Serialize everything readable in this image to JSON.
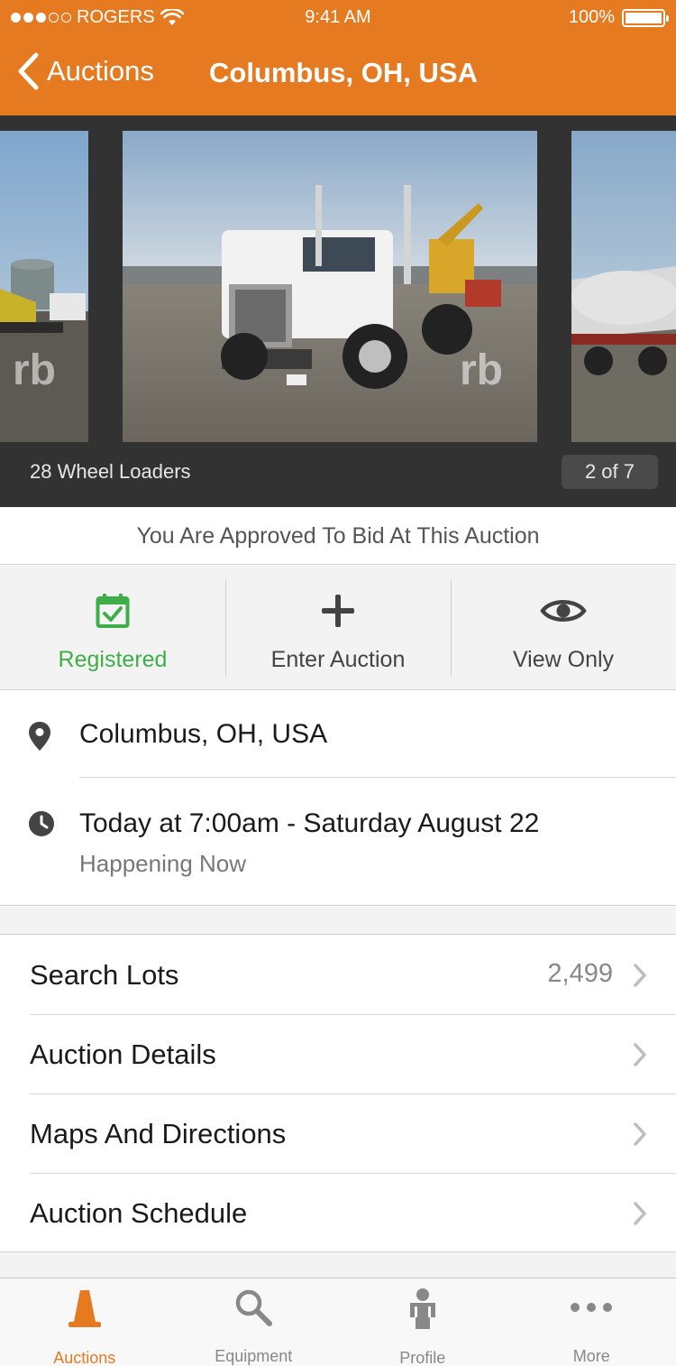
{
  "status_bar": {
    "carrier": "ROGERS",
    "time": "9:41 AM",
    "battery": "100%"
  },
  "nav": {
    "back_label": "Auctions",
    "title": "Columbus, OH, USA"
  },
  "gallery": {
    "caption": "28 Wheel Loaders",
    "counter": "2 of 7",
    "watermark": "rb"
  },
  "approved_text": "You Are Approved To Bid At This Auction",
  "actions": [
    {
      "label": "Registered",
      "icon": "calendar-check-icon"
    },
    {
      "label": "Enter Auction",
      "icon": "plus-icon"
    },
    {
      "label": "View Only",
      "icon": "eye-icon"
    }
  ],
  "info": {
    "location": "Columbus, OH, USA",
    "time": "Today at 7:00am - Saturday August 22",
    "status": "Happening Now"
  },
  "menu": [
    {
      "label": "Search Lots",
      "count": "2,499"
    },
    {
      "label": "Auction Details",
      "count": ""
    },
    {
      "label": "Maps And Directions",
      "count": ""
    },
    {
      "label": "Auction Schedule",
      "count": ""
    }
  ],
  "tabs": [
    {
      "label": "Auctions",
      "icon": "traffic-cone-icon",
      "active": true
    },
    {
      "label": "Equipment",
      "icon": "search-icon",
      "active": false
    },
    {
      "label": "Profile",
      "icon": "person-icon",
      "active": false
    },
    {
      "label": "More",
      "icon": "more-dots-icon",
      "active": false
    }
  ],
  "colors": {
    "brand": "#e57a20",
    "registered": "#3fae49",
    "gallery_bg": "#323232"
  }
}
